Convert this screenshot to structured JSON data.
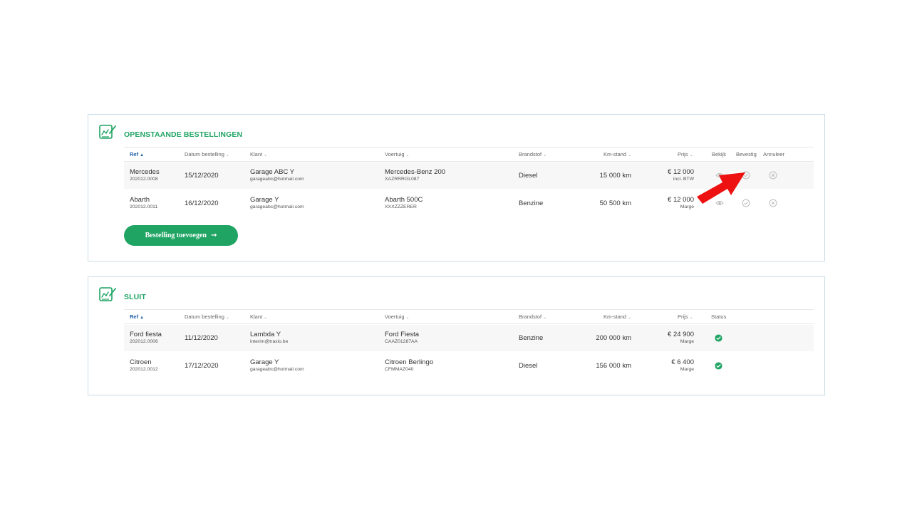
{
  "colors": {
    "accent": "#1fa463",
    "sort_active": "#1d5fa8",
    "panel_border": "#c9dbe6",
    "arrow": "#ee1111"
  },
  "open_orders": {
    "title": "OPENSTAANDE BESTELLINGEN",
    "icon": "signed-document-icon",
    "columns": {
      "ref": "Ref",
      "date": "Datum bestelling",
      "client": "Klant",
      "vehicle": "Voertuig",
      "fuel": "Brandstof",
      "km": "Km-stand",
      "price": "Prijs",
      "view": "Bekijk",
      "confirm": "Bevestig",
      "cancel": "Annuleer"
    },
    "rows": [
      {
        "ref": "Mercedes",
        "ref_no": "202012.0008",
        "date": "15/12/2020",
        "client": "Garage ABC Y",
        "email": "garageabc@hotmail.com",
        "vehicle": "Mercedes-Benz 200",
        "plate": "XAZRRRGL087",
        "fuel": "Diesel",
        "km": "15 000 km",
        "price": "€ 12 000",
        "price_note": "incl. BTW"
      },
      {
        "ref": "Abarth",
        "ref_no": "202012.0011",
        "date": "16/12/2020",
        "client": "Garage Y",
        "email": "garageabc@hotmail.com",
        "vehicle": "Abarth 500C",
        "plate": "XXXZZZERER",
        "fuel": "Benzine",
        "km": "50 500 km",
        "price": "€ 12 000",
        "price_note": "Marge"
      }
    ],
    "add_button": {
      "label": "Bestelling toevoegen",
      "arrow": "→"
    }
  },
  "closed_orders": {
    "title": "SLUIT",
    "icon": "signed-document-icon",
    "columns": {
      "ref": "Ref",
      "date": "Datum bestelling",
      "client": "Klant",
      "vehicle": "Voertuig",
      "fuel": "Brandstof",
      "km": "Km-stand",
      "price": "Prijs",
      "status": "Status"
    },
    "rows": [
      {
        "ref": "Ford fiesta",
        "ref_no": "202012.0006",
        "date": "11/12/2020",
        "client": "Lambda Y",
        "email": "interim@traxio.be",
        "vehicle": "Ford Fiesta",
        "plate": "CAAZ01287AA",
        "fuel": "Benzine",
        "km": "200 000 km",
        "price": "€ 24 900",
        "price_note": "Marge",
        "status": "check-circle-icon"
      },
      {
        "ref": "Citroen",
        "ref_no": "202012.0012",
        "date": "17/12/2020",
        "client": "Garage Y",
        "email": "garageabc@hotmail.com",
        "vehicle": "Citroen Berlingo",
        "plate": "CFMMAZ040",
        "fuel": "Diesel",
        "km": "156 000 km",
        "price": "€ 6 400",
        "price_note": "Marge",
        "status": "check-circle-icon"
      }
    ]
  }
}
